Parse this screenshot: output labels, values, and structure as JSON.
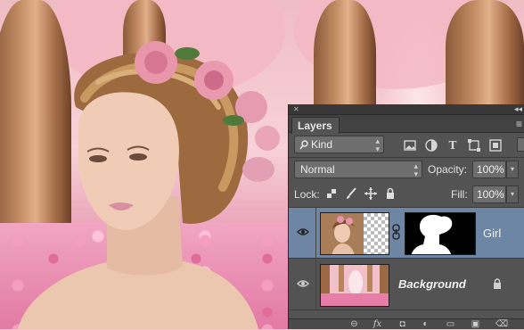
{
  "panel": {
    "tab_label": "Layers",
    "filter": {
      "kind_label": "Kind"
    },
    "blend_mode": "Normal",
    "opacity_label": "Opacity:",
    "opacity_value": "100%",
    "lock_label": "Lock:",
    "fill_label": "Fill:",
    "fill_value": "100%",
    "type_filter_glyph": "T"
  },
  "layers": [
    {
      "name": "Girl",
      "visible": true,
      "selected": true,
      "has_mask": true,
      "locked": false
    },
    {
      "name": "Background",
      "visible": true,
      "selected": false,
      "has_mask": false,
      "locked": true
    }
  ],
  "colors": {
    "panel_bg": "#535353",
    "selected_row": "#6e86a3",
    "tab_bar": "#424242"
  },
  "icons": {
    "filter_icons": [
      "image-filter-icon",
      "adjustment-filter-icon",
      "type-filter-icon",
      "shape-filter-icon",
      "smart-object-filter-icon"
    ],
    "lock_icons": [
      "lock-transparent-icon",
      "lock-image-icon",
      "lock-position-icon",
      "lock-all-icon"
    ],
    "bottom_icons": [
      "link-layers-icon",
      "fx-icon",
      "add-mask-icon",
      "adjustment-layer-icon",
      "new-group-icon",
      "new-layer-icon",
      "trash-icon"
    ]
  }
}
